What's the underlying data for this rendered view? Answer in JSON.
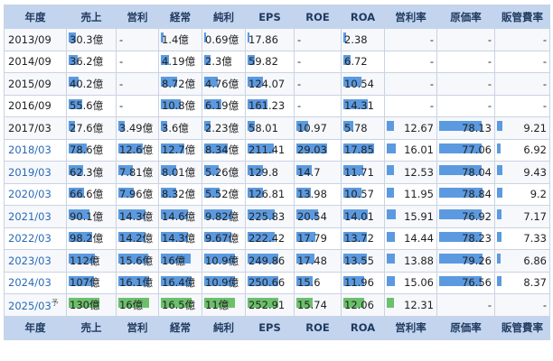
{
  "colors": {
    "bar_actual": "#5b9ae0",
    "bar_forecast": "#6cc06c",
    "header_bg": "#c3d4ee",
    "link": "#2a6ab8"
  },
  "columns": [
    "年度",
    "売上",
    "営利",
    "経常",
    "純利",
    "EPS",
    "ROE",
    "ROA",
    "営利率",
    "原価率",
    "販管費率"
  ],
  "rows": [
    {
      "year": "2013/09",
      "link": false,
      "forecast": false,
      "suffix": "",
      "cells": [
        "30.3億",
        "-",
        "1.4億",
        "0.69億",
        "17.86",
        "-",
        "2.38",
        "-",
        "-",
        "-"
      ],
      "levels": [
        0.23,
        null,
        0.08,
        0.06,
        0.07,
        null,
        0.08,
        null,
        null,
        null
      ]
    },
    {
      "year": "2014/09",
      "link": false,
      "forecast": false,
      "suffix": "",
      "cells": [
        "36.2億",
        "-",
        "4.19億",
        "2.3億",
        "59.82",
        "-",
        "6.72",
        "-",
        "-",
        "-"
      ],
      "levels": [
        0.28,
        null,
        0.25,
        0.21,
        0.24,
        null,
        0.23,
        null,
        null,
        null
      ]
    },
    {
      "year": "2015/09",
      "link": false,
      "forecast": false,
      "suffix": "",
      "cells": [
        "40.2億",
        "-",
        "8.72億",
        "4.76億",
        "124.07",
        "-",
        "10.54",
        "-",
        "-",
        "-"
      ],
      "levels": [
        0.31,
        null,
        0.53,
        0.44,
        0.49,
        null,
        0.59,
        null,
        null,
        null
      ]
    },
    {
      "year": "2016/09",
      "link": false,
      "forecast": false,
      "suffix": "",
      "cells": [
        "55.6億",
        "-",
        "10.8億",
        "6.19億",
        "161.23",
        "-",
        "14.31",
        "-",
        "-",
        "-"
      ],
      "levels": [
        0.43,
        null,
        0.66,
        0.57,
        0.64,
        null,
        0.8,
        null,
        null,
        null
      ]
    },
    {
      "year": "2017/03",
      "link": false,
      "forecast": false,
      "suffix": "",
      "cells": [
        "27.6億",
        "3.49億",
        "3.6億",
        "2.23億",
        "58.01",
        "10.97",
        "5.78",
        "12.67",
        "78.13",
        "9.21"
      ],
      "levels": [
        0.21,
        0.21,
        0.22,
        0.2,
        0.23,
        0.38,
        0.32,
        0.79,
        0.98,
        0.97
      ]
    },
    {
      "year": "2018/03",
      "link": true,
      "forecast": false,
      "suffix": "",
      "cells": [
        "78.6億",
        "12.6億",
        "12.7億",
        "8.34億",
        "211.41",
        "29.03",
        "17.85",
        "16.01",
        "77.06",
        "6.92"
      ],
      "levels": [
        0.6,
        0.78,
        0.77,
        0.77,
        0.84,
        1.0,
        1.0,
        1.0,
        0.97,
        0.73
      ]
    },
    {
      "year": "2019/03",
      "link": true,
      "forecast": false,
      "suffix": "",
      "cells": [
        "62.3億",
        "7.81億",
        "8.01億",
        "5.26億",
        "129.8",
        "14.7",
        "11.71",
        "12.53",
        "78.04",
        "9.43"
      ],
      "levels": [
        0.48,
        0.48,
        0.49,
        0.48,
        0.51,
        0.51,
        0.66,
        0.78,
        0.98,
        1.0
      ]
    },
    {
      "year": "2020/03",
      "link": true,
      "forecast": false,
      "suffix": "",
      "cells": [
        "66.6億",
        "7.96億",
        "8.32億",
        "5.52億",
        "126.81",
        "13.98",
        "10.57",
        "11.95",
        "78.84",
        "9.2"
      ],
      "levels": [
        0.51,
        0.49,
        0.5,
        0.51,
        0.5,
        0.48,
        0.59,
        0.75,
        0.99,
        0.98
      ]
    },
    {
      "year": "2021/03",
      "link": true,
      "forecast": false,
      "suffix": "",
      "cells": [
        "90.1億",
        "14.3億",
        "14.6億",
        "9.82億",
        "225.83",
        "20.54",
        "14.01",
        "15.91",
        "76.92",
        "7.17"
      ],
      "levels": [
        0.69,
        0.88,
        0.89,
        0.9,
        0.89,
        0.71,
        0.78,
        0.99,
        0.97,
        0.76
      ]
    },
    {
      "year": "2022/03",
      "link": true,
      "forecast": false,
      "suffix": "",
      "cells": [
        "98.2億",
        "14.2億",
        "14.3億",
        "9.67億",
        "222.42",
        "17.79",
        "13.72",
        "14.44",
        "78.23",
        "7.33"
      ],
      "levels": [
        0.76,
        0.88,
        0.87,
        0.89,
        0.88,
        0.61,
        0.77,
        0.9,
        0.98,
        0.78
      ]
    },
    {
      "year": "2023/03",
      "link": true,
      "forecast": false,
      "suffix": "",
      "cells": [
        "112億",
        "15.6億",
        "16億",
        "10.9億",
        "249.86",
        "17.48",
        "13.55",
        "13.88",
        "79.26",
        "6.86"
      ],
      "levels": [
        0.86,
        0.97,
        0.97,
        1.0,
        0.99,
        0.6,
        0.76,
        0.87,
        1.0,
        0.73
      ]
    },
    {
      "year": "2024/03",
      "link": true,
      "forecast": false,
      "suffix": "",
      "cells": [
        "107億",
        "16.1億",
        "16.4億",
        "10.9億",
        "250.66",
        "15.6",
        "11.96",
        "15.06",
        "76.56",
        "8.37"
      ],
      "levels": [
        0.82,
        1.0,
        0.99,
        1.0,
        0.99,
        0.54,
        0.67,
        0.94,
        0.97,
        0.89
      ]
    },
    {
      "year": "2025/03",
      "link": true,
      "forecast": true,
      "suffix": "予",
      "cells": [
        "130億",
        "16億",
        "16.5億",
        "11億",
        "252.91",
        "15.74",
        "12.06",
        "12.31",
        "-",
        "-"
      ],
      "levels": [
        1.0,
        0.99,
        1.0,
        1.0,
        1.0,
        0.54,
        0.68,
        0.77,
        null,
        null
      ]
    }
  ]
}
